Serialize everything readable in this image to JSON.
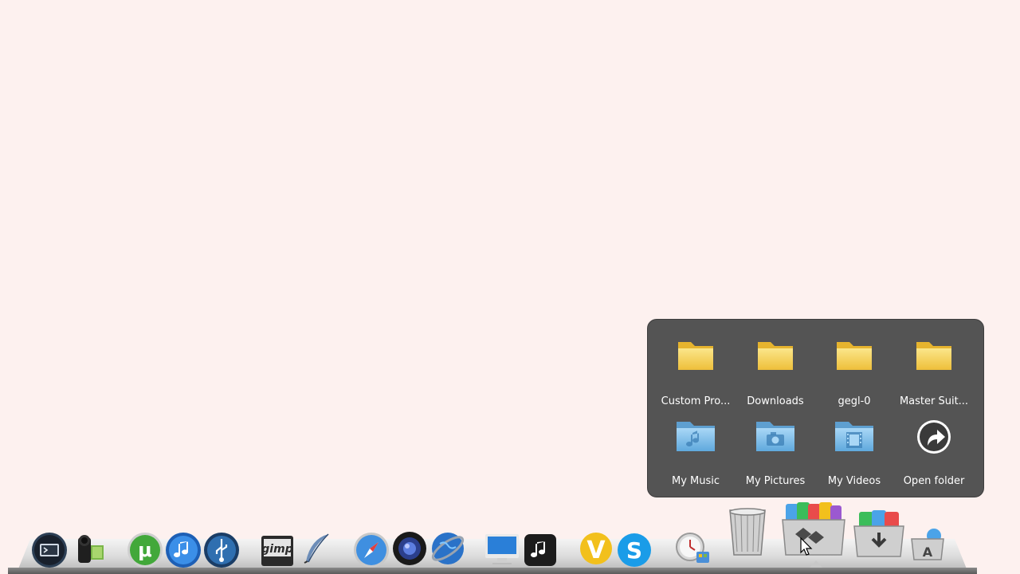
{
  "stack": {
    "items": [
      {
        "label": "Custom Pro...",
        "icon": "folder-icon"
      },
      {
        "label": "Downloads",
        "icon": "folder-icon"
      },
      {
        "label": "gegl-0",
        "icon": "folder-icon"
      },
      {
        "label": "Master Suit...",
        "icon": "folder-icon"
      },
      {
        "label": "My Music",
        "icon": "music-folder-icon"
      },
      {
        "label": "My Pictures",
        "icon": "pictures-folder-icon"
      },
      {
        "label": "My Videos",
        "icon": "videos-folder-icon"
      },
      {
        "label": "Open folder",
        "icon": "open-folder-arrow-icon"
      }
    ]
  },
  "dock": {
    "icons": [
      "terminal-icon",
      "camcorder-icon",
      "utorrent-icon",
      "itunes-icon",
      "usb-icon",
      "gimp-icon",
      "quill-icon",
      "safari-icon",
      "webcam-icon",
      "globe-icon",
      "imac-icon",
      "music-app-icon",
      "v-app-icon",
      "skype-icon",
      "time-settings-icon",
      "trash-icon",
      "stack-icon",
      "downloads-stack-icon",
      "app-store-icon"
    ],
    "badges": {
      "utorrent": "μ",
      "gimp": "gimp",
      "v_app": "V",
      "skype": "S",
      "app_store": "A"
    }
  },
  "colors": {
    "desktop": "#fdf1ef",
    "popup": "#545454",
    "folder_yellow": "#f6d25d",
    "folder_blue": "#7fbee8"
  }
}
